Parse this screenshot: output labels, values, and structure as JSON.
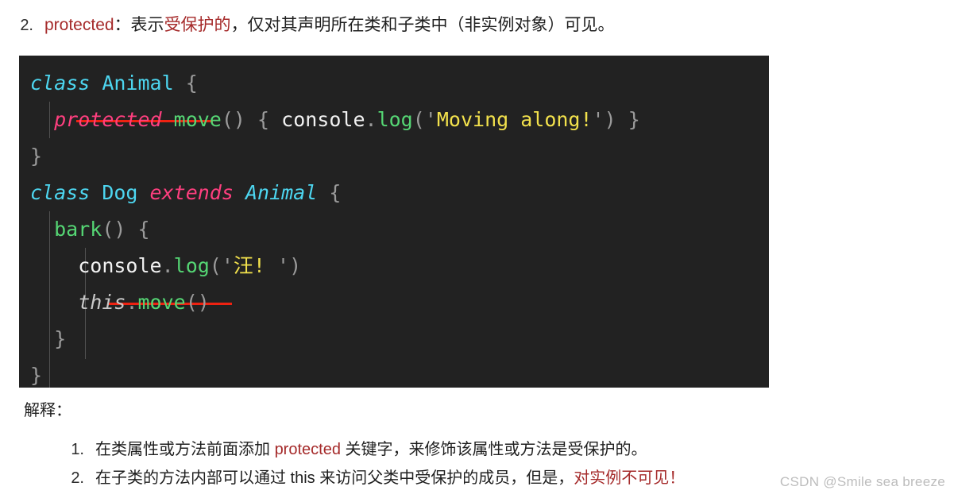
{
  "top_item": {
    "marker": "2.",
    "keyword": "protected",
    "separator": "：表示",
    "emphasis": "受保护的",
    "rest": "，仅对其声明所在类和子类中（非实例对象）可见。",
    "keyword_color": "#a52a2a"
  },
  "code": {
    "background": "#222222",
    "lines": [
      {
        "tokens": [
          {
            "text": "class",
            "kind": "keyword"
          },
          {
            "text": " ",
            "kind": "plain"
          },
          {
            "text": "Animal",
            "kind": "type"
          },
          {
            "text": " ",
            "kind": "plain"
          },
          {
            "text": "{",
            "kind": "punctuation"
          }
        ]
      },
      {
        "tokens": [
          {
            "text": "  ",
            "kind": "plain"
          },
          {
            "text": "protected",
            "kind": "modifier"
          },
          {
            "text": " ",
            "kind": "plain"
          },
          {
            "text": "move",
            "kind": "function"
          },
          {
            "text": "()",
            "kind": "punctuation"
          },
          {
            "text": " ",
            "kind": "plain"
          },
          {
            "text": "{",
            "kind": "punctuation"
          },
          {
            "text": " ",
            "kind": "plain"
          },
          {
            "text": "console",
            "kind": "plain"
          },
          {
            "text": ".",
            "kind": "punctuation"
          },
          {
            "text": "log",
            "kind": "function"
          },
          {
            "text": "(",
            "kind": "punctuation"
          },
          {
            "text": "'",
            "kind": "punctuation"
          },
          {
            "text": "Moving along!",
            "kind": "string"
          },
          {
            "text": "'",
            "kind": "punctuation"
          },
          {
            "text": ")",
            "kind": "punctuation"
          },
          {
            "text": " ",
            "kind": "plain"
          },
          {
            "text": "}",
            "kind": "punctuation"
          }
        ]
      },
      {
        "tokens": [
          {
            "text": "}",
            "kind": "punctuation"
          }
        ]
      },
      {
        "tokens": [
          {
            "text": "class",
            "kind": "keyword"
          },
          {
            "text": " ",
            "kind": "plain"
          },
          {
            "text": "Dog",
            "kind": "type"
          },
          {
            "text": " ",
            "kind": "plain"
          },
          {
            "text": "extends",
            "kind": "extends"
          },
          {
            "text": " ",
            "kind": "plain"
          },
          {
            "text": "Animal",
            "kind": "type-italic"
          },
          {
            "text": " ",
            "kind": "plain"
          },
          {
            "text": "{",
            "kind": "punctuation"
          }
        ]
      },
      {
        "tokens": [
          {
            "text": "  ",
            "kind": "plain"
          },
          {
            "text": "bark",
            "kind": "function"
          },
          {
            "text": "()",
            "kind": "punctuation"
          },
          {
            "text": " ",
            "kind": "plain"
          },
          {
            "text": "{",
            "kind": "punctuation"
          }
        ]
      },
      {
        "tokens": [
          {
            "text": "    ",
            "kind": "plain"
          },
          {
            "text": "console",
            "kind": "plain"
          },
          {
            "text": ".",
            "kind": "punctuation"
          },
          {
            "text": "log",
            "kind": "function"
          },
          {
            "text": "(",
            "kind": "punctuation"
          },
          {
            "text": "'",
            "kind": "punctuation"
          },
          {
            "text": "汪! ",
            "kind": "string"
          },
          {
            "text": "'",
            "kind": "punctuation"
          },
          {
            "text": ")",
            "kind": "punctuation"
          }
        ]
      },
      {
        "tokens": [
          {
            "text": "    ",
            "kind": "plain"
          },
          {
            "text": "this",
            "kind": "this"
          },
          {
            "text": ".",
            "kind": "punctuation"
          },
          {
            "text": "move",
            "kind": "function"
          },
          {
            "text": "()",
            "kind": "punctuation"
          }
        ]
      },
      {
        "tokens": [
          {
            "text": "  ",
            "kind": "plain"
          },
          {
            "text": "}",
            "kind": "punctuation"
          }
        ]
      },
      {
        "tokens": [
          {
            "text": "}",
            "kind": "punctuation"
          }
        ]
      }
    ],
    "error_underlines": [
      {
        "target": "protected"
      },
      {
        "target": "this.move"
      }
    ],
    "colors": {
      "keyword": "#4dd6f0",
      "type": "#4dd6f0",
      "modifier": "#ff3f7f",
      "function": "#55d674",
      "string": "#f2e14c",
      "punctuation": "#9b9b9b",
      "plain": "#f2f2f2",
      "this": "#c8c8c8",
      "underline": "#ee2211"
    }
  },
  "explanation": {
    "title": "解释：",
    "items": [
      {
        "marker": "1.",
        "prefix": "在类属性或方法前面添加 ",
        "keyword": "protected",
        "suffix": " 关键字，来修饰该属性或方法是受保护的。",
        "emphasis": "",
        "tail": ""
      },
      {
        "marker": "2.",
        "prefix": "在子类的方法内部可以通过 this 来访问父类中受保护的成员，但是，",
        "keyword": "",
        "suffix": "",
        "emphasis": "对实例不可见！",
        "tail": ""
      }
    ]
  },
  "watermark": {
    "text": "CSDN @Smile sea breeze"
  }
}
